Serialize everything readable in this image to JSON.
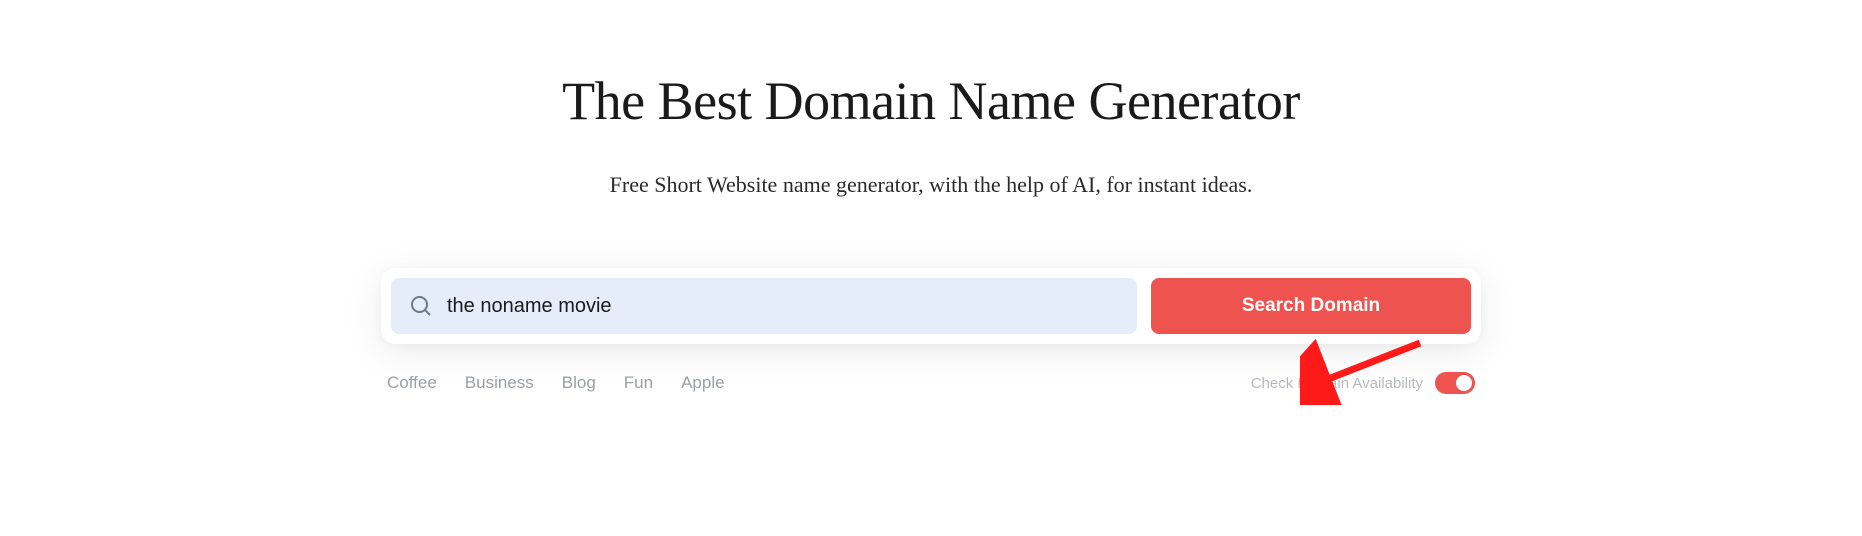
{
  "hero": {
    "title": "The Best Domain Name Generator",
    "subtitle": "Free Short Website name generator, with the help of AI, for instant ideas."
  },
  "search": {
    "value": "the noname movie",
    "button": "Search Domain"
  },
  "tags": {
    "items": [
      "Coffee",
      "Business",
      "Blog",
      "Fun",
      "Apple"
    ]
  },
  "toggle": {
    "label": "Check Domain Availability",
    "on": true
  }
}
